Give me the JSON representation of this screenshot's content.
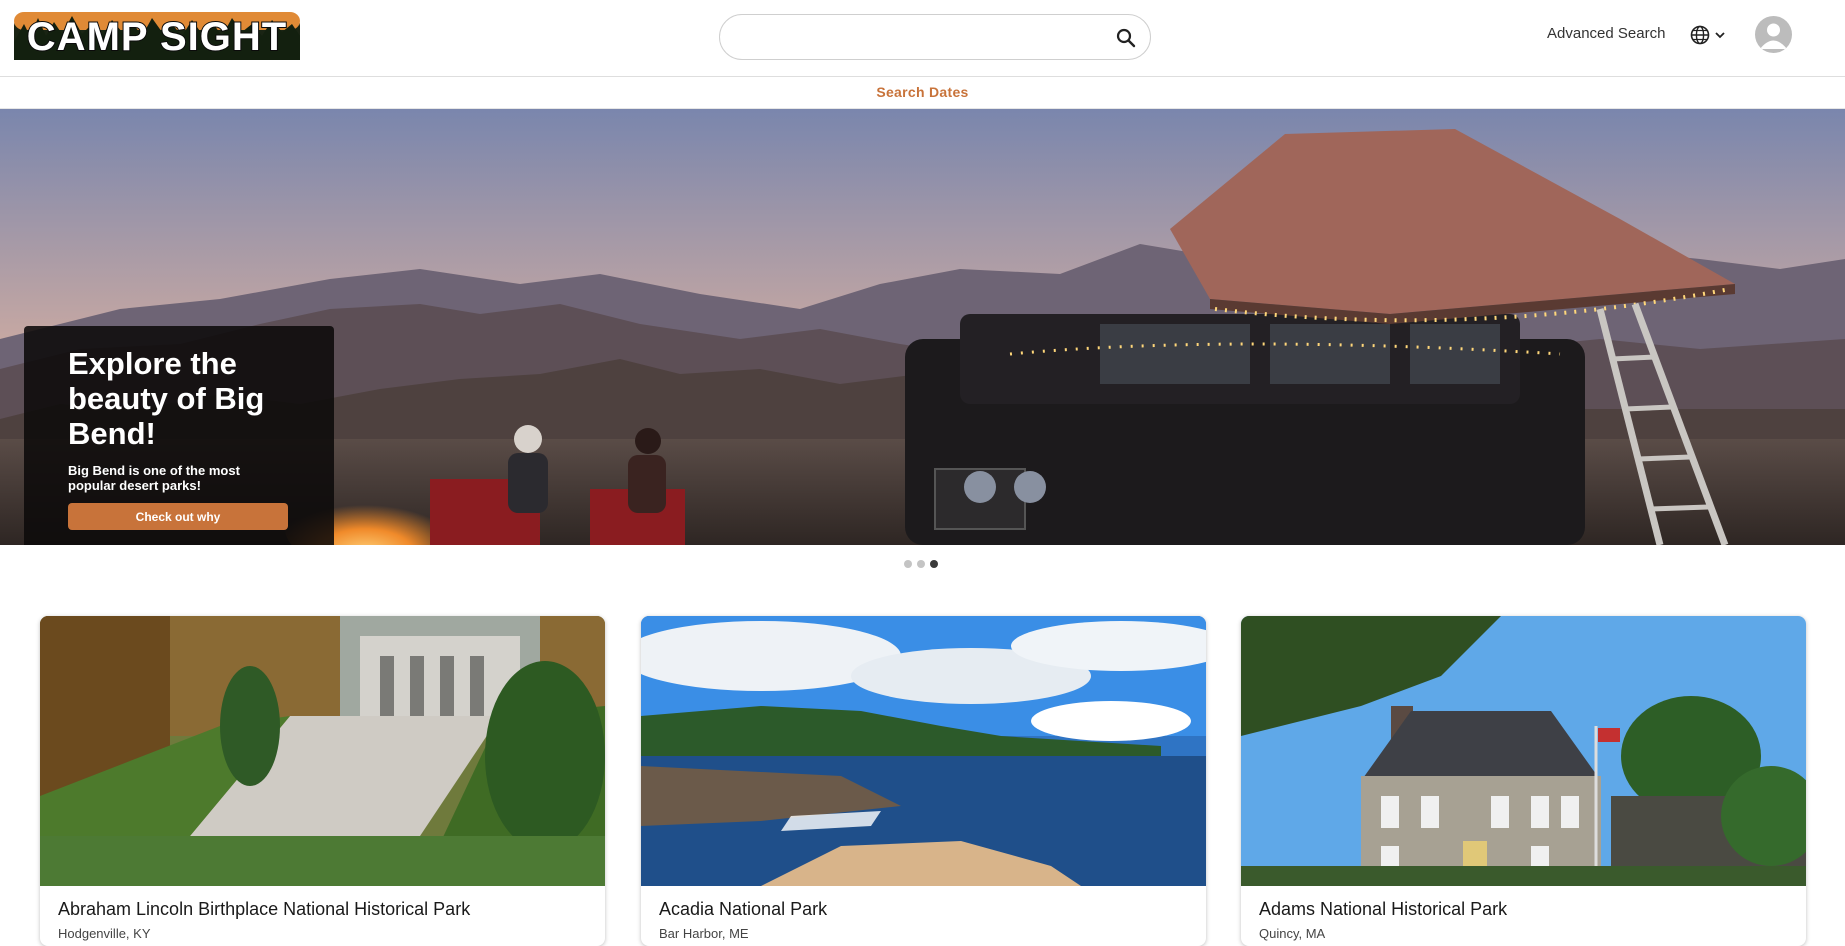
{
  "header": {
    "logo_text": "CAMP SIGHT",
    "search": {
      "value": "",
      "placeholder": ""
    },
    "advanced_search_label": "Advanced Search",
    "language_icon": "globe-icon",
    "user_icon": "user-avatar-icon"
  },
  "subnav": {
    "search_dates_label": "Search Dates"
  },
  "hero": {
    "title": "Explore the beauty of Big Bend!",
    "text": "Big Bend is one of the most popular desert parks!",
    "button_label": "Check out why",
    "slide_count": 3,
    "active_slide": 3
  },
  "cards": [
    {
      "title": "Abraham Lincoln Birthplace National Historical Park",
      "location": "Hodgenville, KY"
    },
    {
      "title": "Acadia National Park",
      "location": "Bar Harbor, ME"
    },
    {
      "title": "Adams National Historical Park",
      "location": "Quincy, MA"
    }
  ],
  "colors": {
    "accent": "#c8733a",
    "promo_bg": "#0c0a0a",
    "dot_active": "#3a3a3a",
    "dot_inactive": "#c4c4c4"
  }
}
